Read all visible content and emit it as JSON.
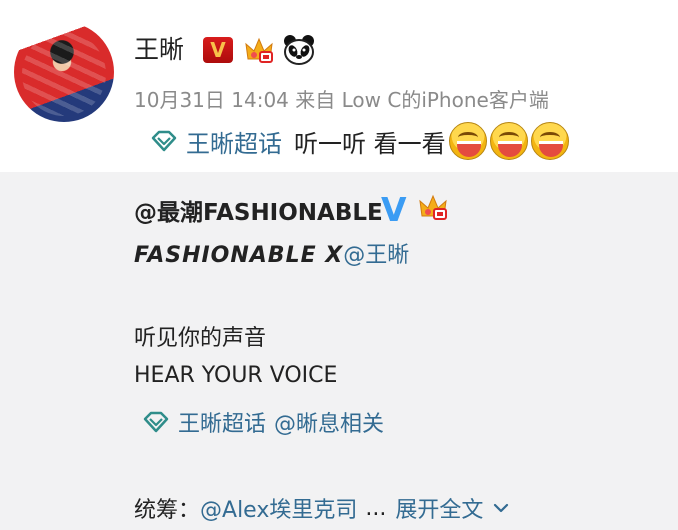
{
  "post": {
    "author_name": "王晰",
    "vip_badge": "V",
    "meta": "10月31日 14:04 来自 Low C的iPhone客户端",
    "topic_link": "王晰超话",
    "text": "听一听 看一看"
  },
  "repost": {
    "author": "@最潮FASHIONABLE",
    "verified_badge": "V",
    "title_text": "FASHIONABLE X",
    "title_mention": "@王晰",
    "line1": "听见你的声音",
    "line2": "HEAR YOUR VOICE",
    "topic_link": "王晰超话",
    "related_link": "@晰息相关",
    "credits_label": "统筹：",
    "credits_mention": "@Alex埃里克司",
    "ellipsis": "...",
    "expand_label": "展开全文"
  },
  "colors": {
    "link": "#336b92",
    "repost_background": "#f2f2f3",
    "verified_blue": "#3b9cf3",
    "vip_red": "#d81c1c"
  },
  "icons": [
    "topic-diamond-icon",
    "crown-badge-icon",
    "panda-badge-icon",
    "laughing-emoji-icon",
    "chevron-down-icon"
  ]
}
